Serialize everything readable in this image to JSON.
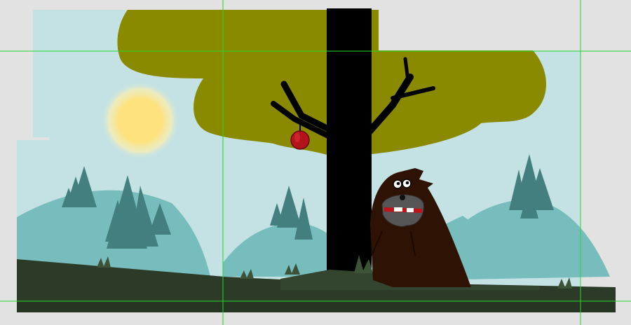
{
  "scene": {
    "colors": {
      "canvas_bg": "#e2e2e2",
      "sky": "#c4e2e4",
      "sun_core": "#fde27e",
      "sun_glow": "#fdf0b0",
      "hills": "#78bdbd",
      "pine_trees": "#447f80",
      "ground_dark": "#2b3b27",
      "ground_mid": "#33452e",
      "grass": "#3d5337",
      "tree_trunk": "#000000",
      "canopy": "#8a8a00",
      "apple": "#b3141b",
      "creature_fur": "#2e1305",
      "creature_muzzle": "#555555",
      "guide_lines": "#27d82a"
    },
    "icons": {
      "sun": "sun-icon",
      "apple": "apple-icon",
      "creature": "furry-monster-sprite"
    }
  }
}
